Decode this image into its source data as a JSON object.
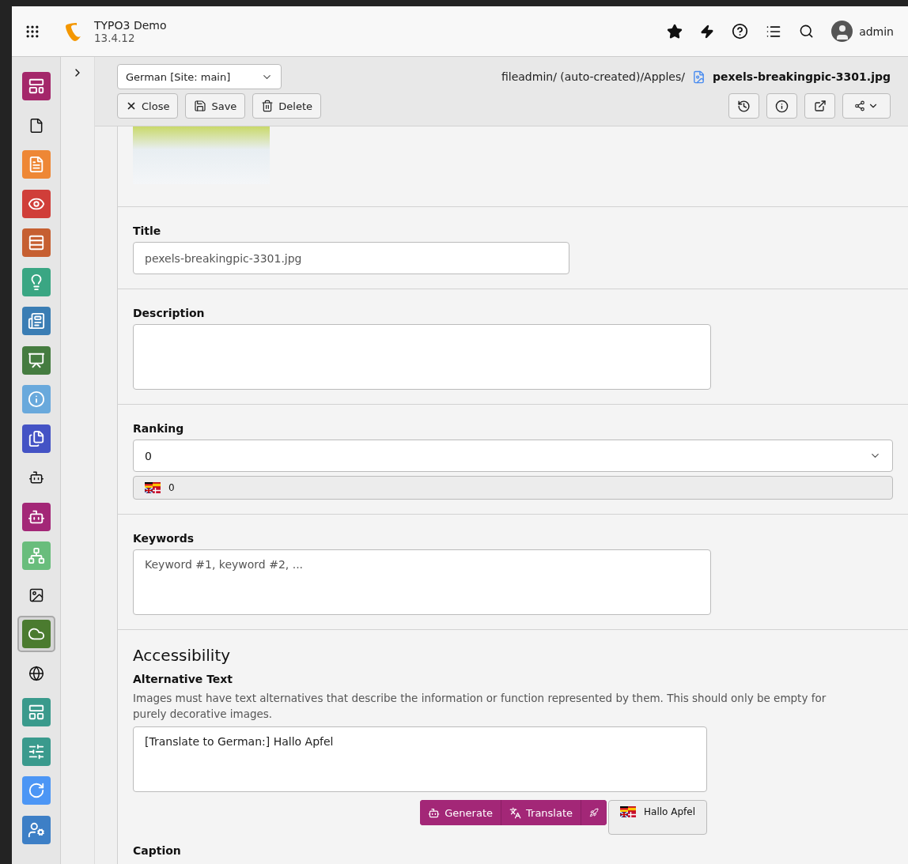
{
  "app": {
    "title": "TYPO3 Demo",
    "version": "13.4.12"
  },
  "user": {
    "name": "admin"
  },
  "modules": [
    {
      "kind": "tile",
      "color": "#a4276a",
      "selected": false
    },
    {
      "kind": "plain",
      "selected": false
    },
    {
      "kind": "tile",
      "color": "#ee8735",
      "selected": false
    },
    {
      "kind": "tile",
      "color": "#d03e39",
      "selected": false
    },
    {
      "kind": "tile",
      "color": "#c65f31",
      "selected": false
    },
    {
      "kind": "tile",
      "color": "#3aa683",
      "selected": false
    },
    {
      "kind": "tile",
      "color": "#3a7db4",
      "selected": false
    },
    {
      "kind": "tile",
      "color": "#457c40",
      "selected": false
    },
    {
      "kind": "tile",
      "color": "#69a9dc",
      "selected": false
    },
    {
      "kind": "tile",
      "color": "#4453c5",
      "selected": false
    },
    {
      "kind": "plain",
      "selected": false
    },
    {
      "kind": "tile",
      "color": "#a32777",
      "selected": false
    },
    {
      "kind": "tile",
      "color": "#69bd7c",
      "selected": false
    },
    {
      "kind": "plain",
      "selected": false
    },
    {
      "kind": "tile",
      "color": "#4b7b2f",
      "selected": true
    },
    {
      "kind": "plain",
      "selected": false
    },
    {
      "kind": "tile",
      "color": "#3a9a8c",
      "selected": false
    },
    {
      "kind": "tile",
      "color": "#3a9a8d",
      "selected": false
    },
    {
      "kind": "tile",
      "color": "#4c96f5",
      "selected": false
    },
    {
      "kind": "tile",
      "color": "#3d7fc6",
      "selected": false
    }
  ],
  "docheader": {
    "language": "German [Site: main]",
    "path": "fileadmin/ (auto-created)/Apples/",
    "file": "pexels-breakingpic-3301.jpg",
    "buttons": [
      {
        "label": "Close"
      },
      {
        "label": "Save"
      },
      {
        "label": "Delete"
      }
    ]
  },
  "form": {
    "title": {
      "label": "Title",
      "placeholder": "pexels-breakingpic-3301.jpg"
    },
    "description": {
      "label": "Description"
    },
    "ranking": {
      "label": "Ranking",
      "value": "0",
      "original": "0"
    },
    "keywords": {
      "label": "Keywords",
      "placeholder": "Keyword #1, keyword #2, ..."
    },
    "accessibility": {
      "heading": "Accessibility",
      "label": "Alternative Text",
      "help": "Images must have text alternatives that describe the information or function represented by them. This should only be empty for purely decorative images.",
      "value": "[Translate to German:] Hallo Apfel",
      "buttons": [
        "Generate",
        "Translate"
      ],
      "original": "Hallo Apfel"
    },
    "caption": {
      "label": "Caption"
    }
  }
}
